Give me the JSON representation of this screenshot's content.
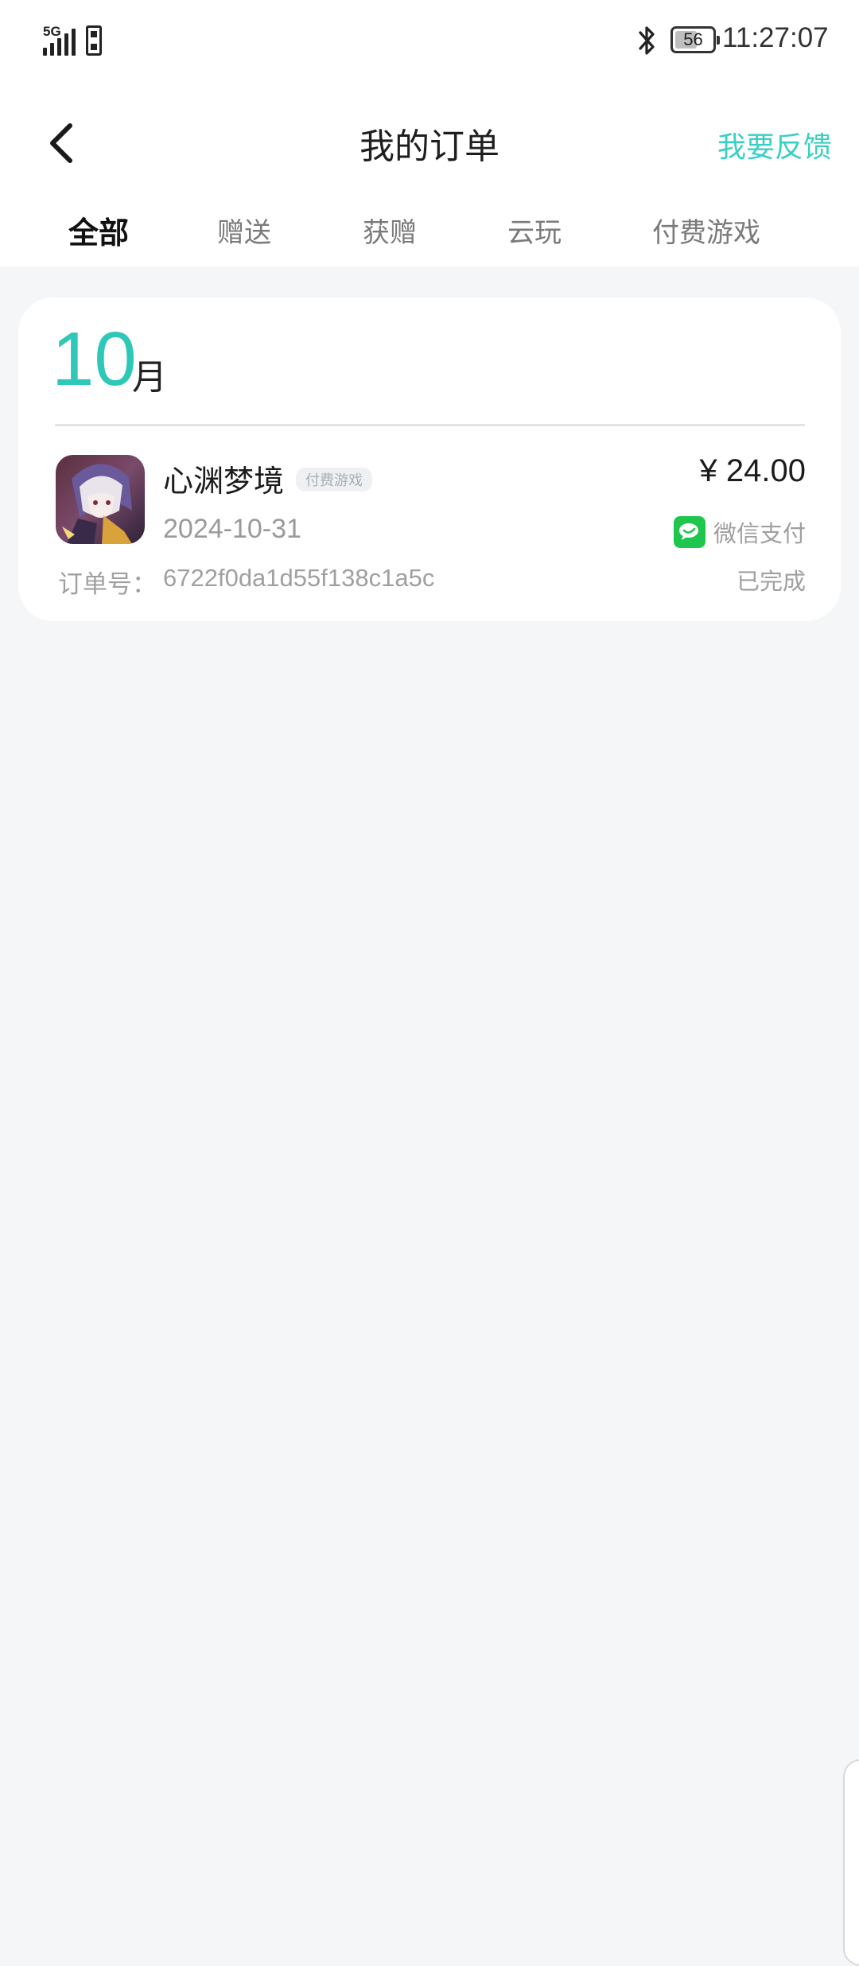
{
  "status_bar": {
    "network": "5G",
    "battery_level": "56",
    "time": "11:27:07"
  },
  "header": {
    "title": "我的订单",
    "feedback_label": "我要反馈"
  },
  "tabs": [
    {
      "label": "全部",
      "active": true
    },
    {
      "label": "赠送",
      "active": false
    },
    {
      "label": "获赠",
      "active": false
    },
    {
      "label": "云玩",
      "active": false
    },
    {
      "label": "付费游戏",
      "active": false
    }
  ],
  "month_group": {
    "month": "10",
    "unit": "月",
    "orders": [
      {
        "game_name": "心渊梦境",
        "tag": "付费游戏",
        "date": "2024-10-31",
        "order_no_label": "订单号：",
        "order_no": "6722f0da1d55f138c1a5c",
        "price": "¥ 24.00",
        "payment_method": "微信支付",
        "status": "已完成"
      }
    ]
  },
  "colors": {
    "accent": "#39d0c4",
    "tab_indicator": "#2ed2c2",
    "wechat_green": "#1fc64d",
    "background": "#f5f6f8"
  },
  "icons": {
    "back": "chevron-left-icon",
    "bluetooth": "bluetooth-icon",
    "payment": "wechat-pay-icon"
  }
}
